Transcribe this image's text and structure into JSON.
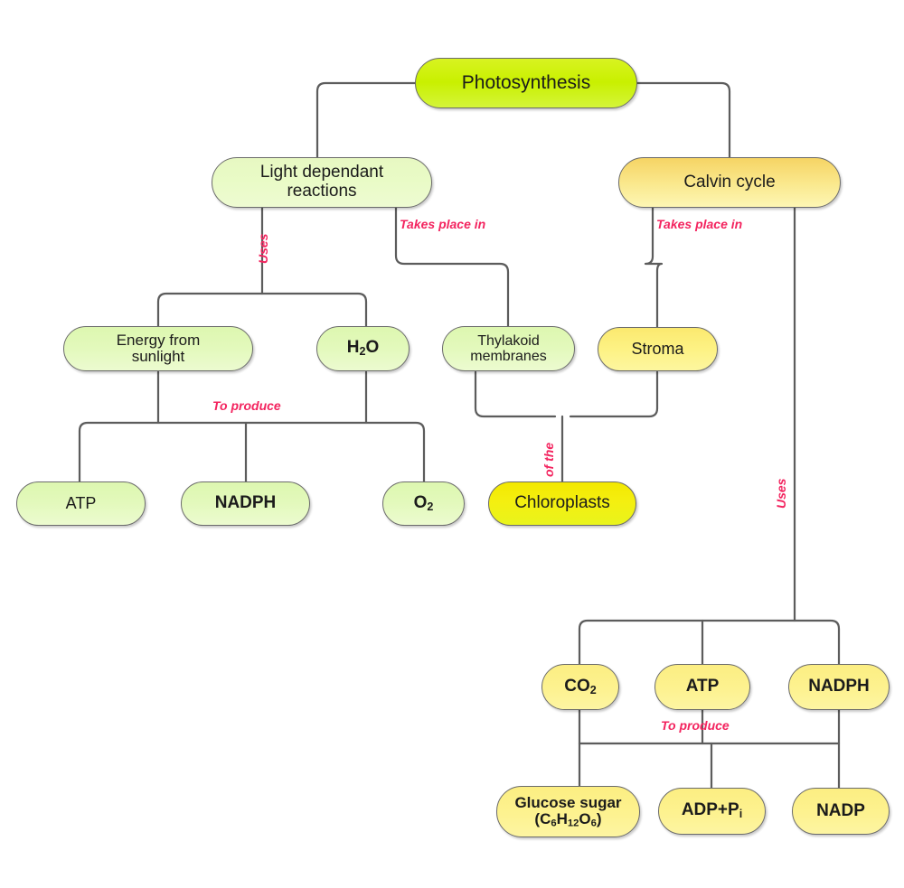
{
  "diagram": {
    "title": "Photosynthesis concept map",
    "colors": {
      "edge_label": "#f3245f",
      "connector": "#5c5c5c",
      "root_fill": "#c9f000",
      "chloroplast_fill": "#f2ef0a",
      "green_fill": "#e7f8c2",
      "yellow_fill": "#fbe96f",
      "amber_fill": "#f6d464"
    },
    "nodes": [
      {
        "id": "photosynthesis",
        "label": "Photosynthesis"
      },
      {
        "id": "light_reactions",
        "label_line1": "Light dependant",
        "label_line2": "reactions"
      },
      {
        "id": "calvin_cycle",
        "label": "Calvin cycle"
      },
      {
        "id": "energy_sunlight",
        "label_line1": "Energy from",
        "label_line2": "sunlight"
      },
      {
        "id": "water",
        "label": "H2O",
        "formula": {
          "base1": "H",
          "sub1": "2",
          "base2": "O"
        }
      },
      {
        "id": "thylakoid",
        "label_line1": "Thylakoid",
        "label_line2": "membranes"
      },
      {
        "id": "stroma",
        "label": "Stroma"
      },
      {
        "id": "atp_left",
        "label": "ATP"
      },
      {
        "id": "nadph_left",
        "label": "NADPH"
      },
      {
        "id": "oxygen",
        "label": "O2",
        "formula": {
          "base1": "O",
          "sub1": "2"
        }
      },
      {
        "id": "chloroplasts",
        "label": "Chloroplasts"
      },
      {
        "id": "co2",
        "label": "CO2",
        "formula": {
          "base1": "CO",
          "sub1": "2"
        }
      },
      {
        "id": "atp_right",
        "label": "ATP"
      },
      {
        "id": "nadph_right",
        "label": "NADPH"
      },
      {
        "id": "glucose",
        "label_line1": "Glucose sugar",
        "label_line2": "(C6H12O6)",
        "formula": {
          "open": "(C",
          "sub1": "6",
          "mid1": "H",
          "sub2": "12",
          "mid2": "O",
          "sub3": "6",
          "close": ")"
        }
      },
      {
        "id": "adp_pi",
        "label": "ADP+Pi",
        "formula": {
          "base1": "ADP+P",
          "sub1": "i"
        }
      },
      {
        "id": "nadp",
        "label": "NADP"
      }
    ],
    "edge_labels": [
      {
        "id": "uses_left",
        "text": "Uses",
        "orientation": "vertical"
      },
      {
        "id": "takes_place_in_light",
        "line1": "Takes",
        "line2": "place in",
        "orientation": "horizontal"
      },
      {
        "id": "takes_place_in_calvin",
        "line1": "Takes",
        "line2": "place in",
        "orientation": "horizontal"
      },
      {
        "id": "to_produce_left",
        "text": "To produce",
        "orientation": "horizontal"
      },
      {
        "id": "of_the",
        "text": "of the",
        "orientation": "vertical"
      },
      {
        "id": "uses_right",
        "text": "Uses",
        "orientation": "vertical"
      },
      {
        "id": "to_produce_right",
        "text": "To produce",
        "orientation": "horizontal"
      }
    ]
  }
}
